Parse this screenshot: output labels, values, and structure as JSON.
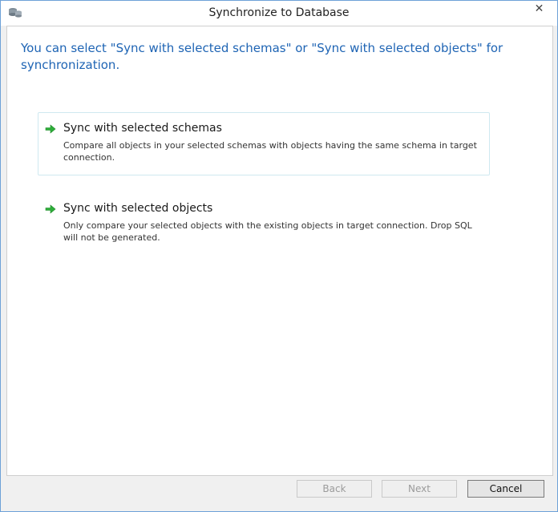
{
  "window": {
    "title": "Synchronize to Database",
    "close_glyph": "✕",
    "icon": "database-sync-icon"
  },
  "intro": {
    "text": "You can select \"Sync with selected schemas\" or \"Sync with selected objects\" for synchronization."
  },
  "options": [
    {
      "title": "Sync with selected schemas",
      "description": "Compare all objects in your selected schemas with objects having the same schema in target connection.",
      "selected": true
    },
    {
      "title": "Sync with selected objects",
      "description": "Only compare your selected objects with the existing objects in target connection. Drop SQL will not be generated.",
      "selected": false
    }
  ],
  "footer": {
    "back_label": "Back",
    "next_label": "Next",
    "cancel_label": "Cancel"
  },
  "colors": {
    "accent_blue": "#1e64b4",
    "arrow_green": "#2eae3a",
    "window_border": "#6ea1d8"
  }
}
